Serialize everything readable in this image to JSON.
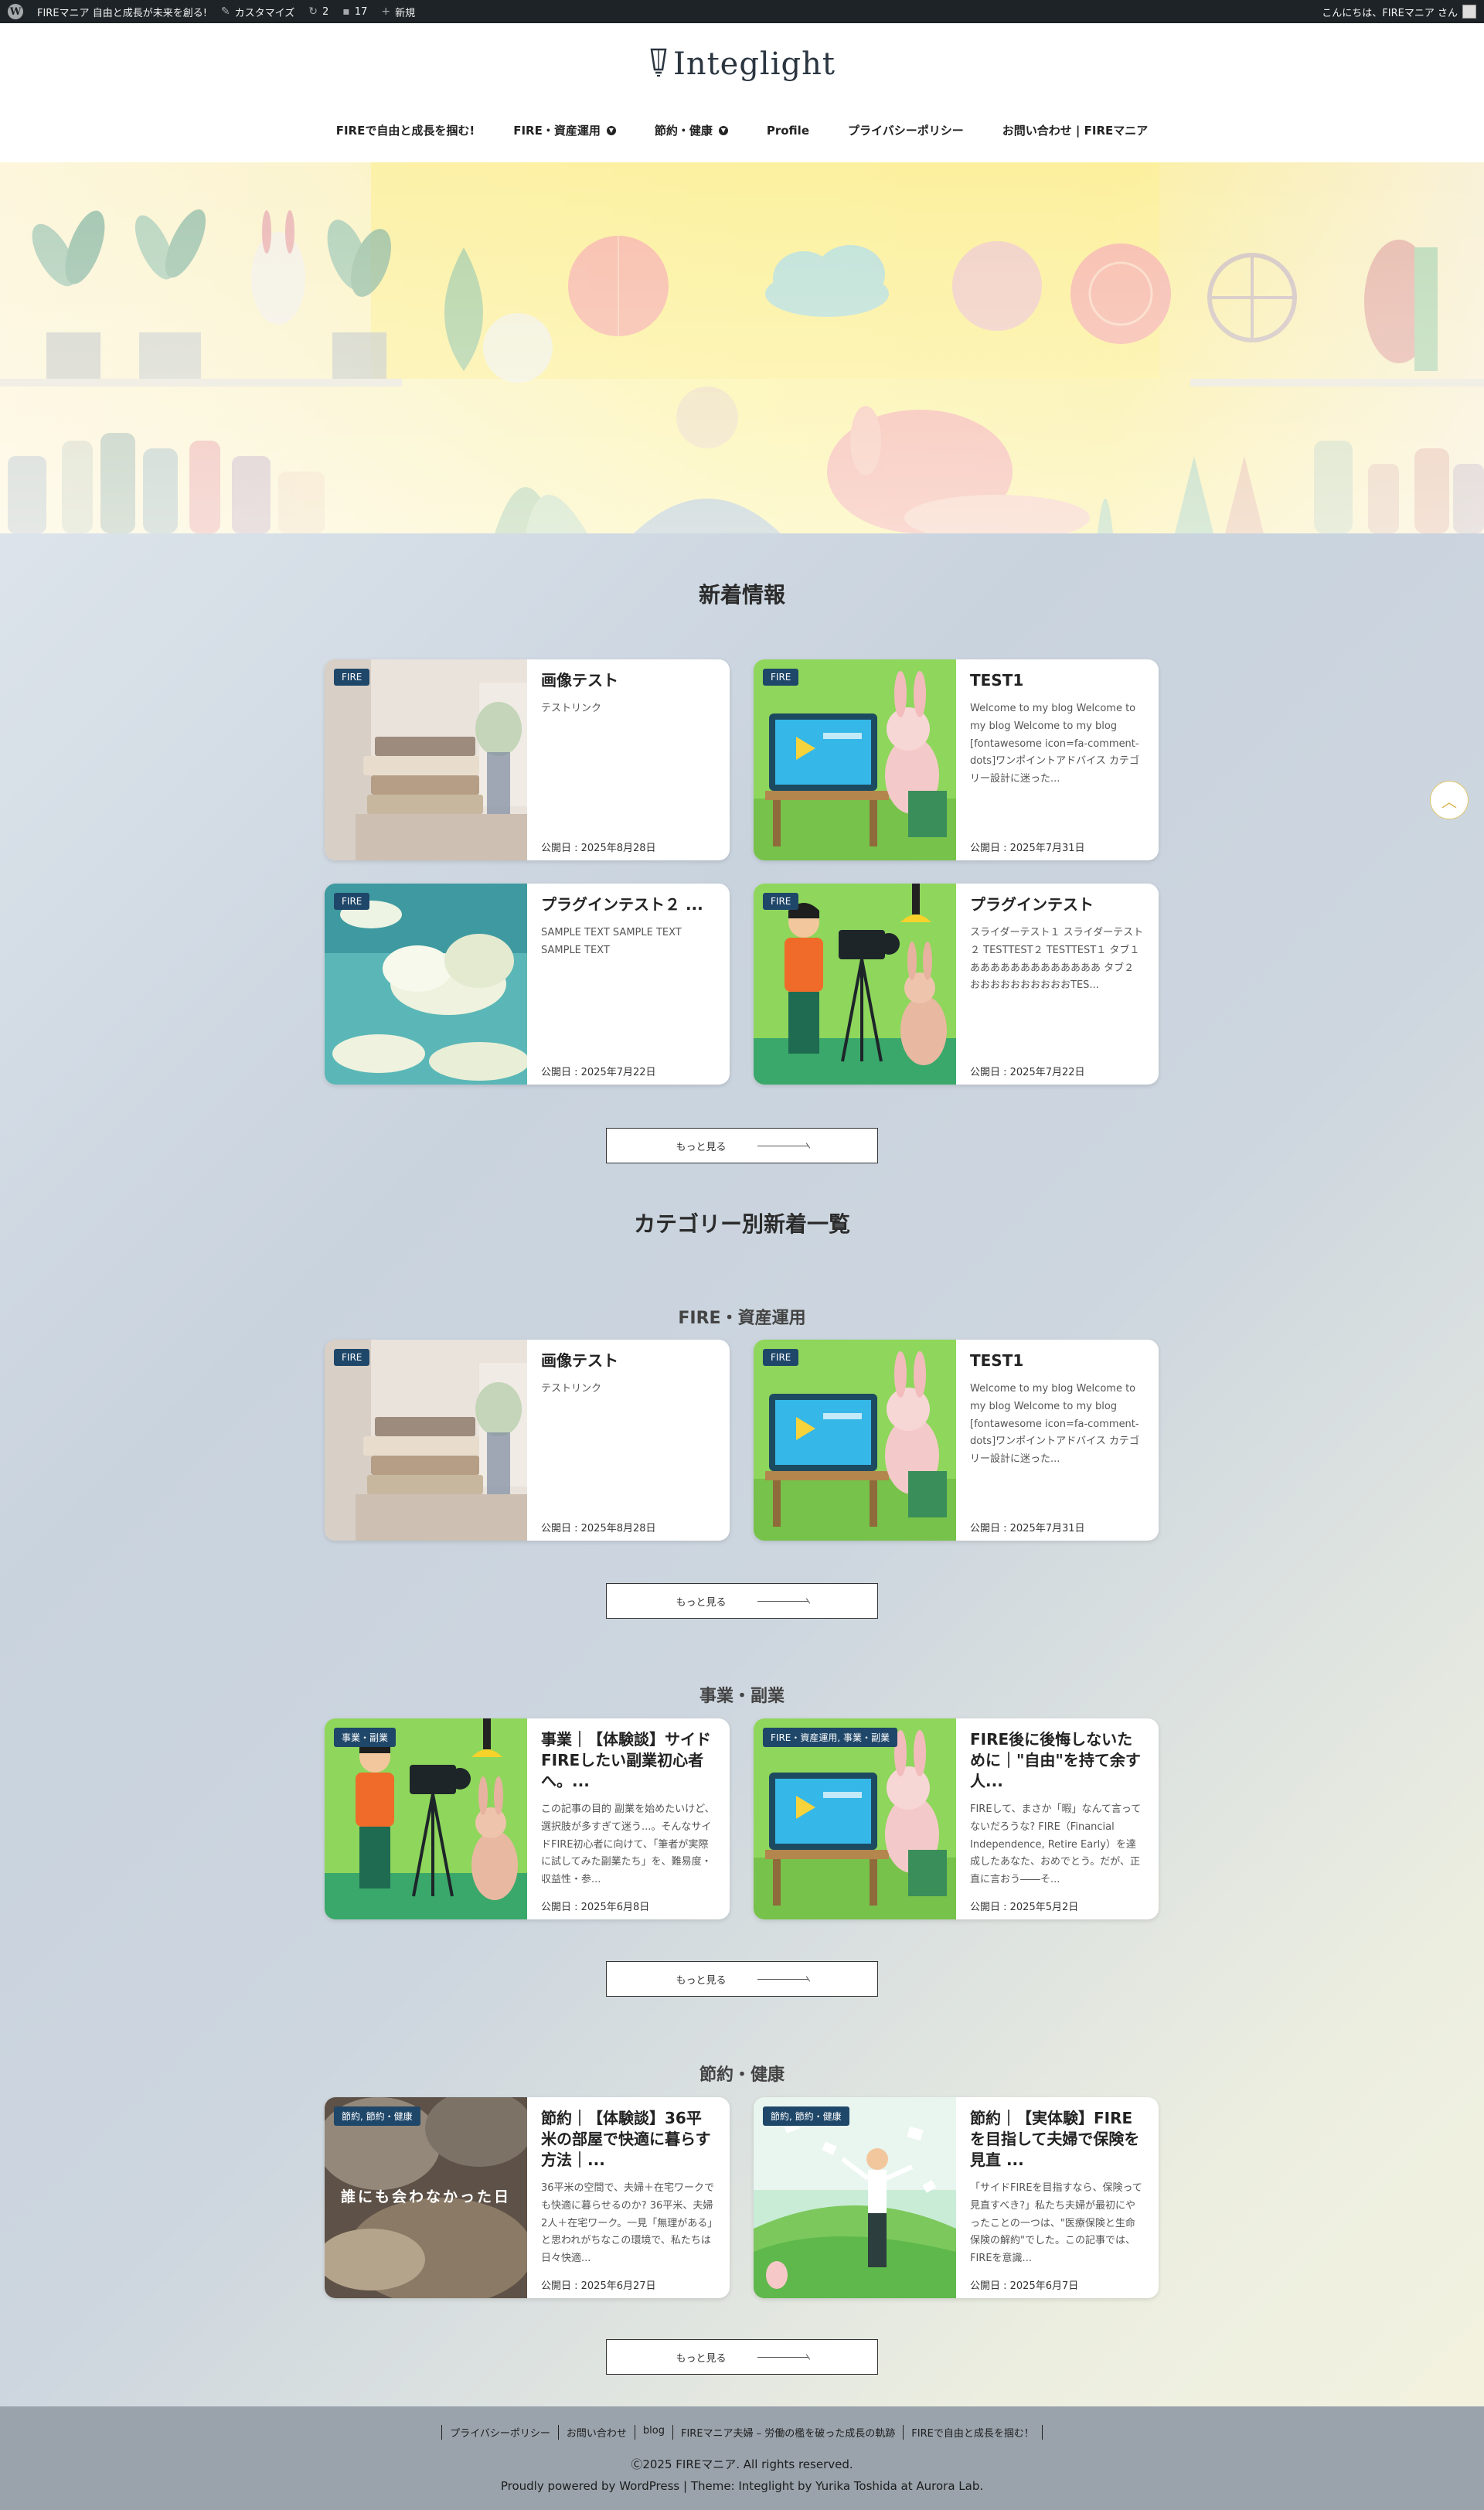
{
  "adminbar": {
    "site_name": "FIREマニア 自由と成長が未来を創る!",
    "customize": "カスタマイズ",
    "updates": "2",
    "comments": "17",
    "new": "新規",
    "greeting": "こんにちは、FIREマニア さん"
  },
  "header": {
    "logo": "Integlight",
    "nav": [
      {
        "label": "FIREで自由と成長を掴む!"
      },
      {
        "label": "FIRE・資産運用"
      },
      {
        "label": "節約・健康"
      },
      {
        "label": "Profile"
      },
      {
        "label": "プライバシーポリシー"
      },
      {
        "label": "お問い合わせ | FIREマニア"
      }
    ]
  },
  "latest": {
    "title": "新着情報",
    "cards": [
      {
        "badge": "FIRE",
        "title": "画像テスト",
        "excerpt": "テストリンク",
        "date": "公開日 : 2025年8月28日",
        "thumb": "books"
      },
      {
        "badge": "FIRE",
        "title": "TEST1",
        "excerpt": "Welcome to my blog Welcome to my blog Welcome to my blog [fontawesome icon=fa-comment-dots]ワンポイントアドバイス カテゴリー設計に迷った...",
        "date": "公開日 : 2025年7月31日",
        "thumb": "rabbit-computer"
      },
      {
        "badge": "FIRE",
        "title": "プラグインテスト２ ...",
        "excerpt": "SAMPLE TEXT SAMPLE TEXT SAMPLE TEXT",
        "date": "公開日 : 2025年7月22日",
        "thumb": "clouds"
      },
      {
        "badge": "FIRE",
        "title": "プラグインテスト",
        "excerpt": "スライダーテスト１ スライダーテスト２ TESTTEST２ TESTTEST１ タブ１ あああああああああああああ タブ２ おおおおおおおおおおTES...",
        "date": "公開日 : 2025年7月22日",
        "thumb": "camera"
      }
    ],
    "more": "もっと見る"
  },
  "category_section": {
    "title": "カテゴリー別新着一覧",
    "groups": [
      {
        "title": "FIRE・資産運用",
        "cards": [
          {
            "badge": "FIRE",
            "title": "画像テスト",
            "excerpt": "テストリンク",
            "date": "公開日 : 2025年8月28日",
            "thumb": "books"
          },
          {
            "badge": "FIRE",
            "title": "TEST1",
            "excerpt": "Welcome to my blog Welcome to my blog Welcome to my blog [fontawesome icon=fa-comment-dots]ワンポイントアドバイス カテゴリー設計に迷った...",
            "date": "公開日 : 2025年7月31日",
            "thumb": "rabbit-computer"
          }
        ],
        "more": "もっと見る"
      },
      {
        "title": "事業・副業",
        "cards": [
          {
            "badge": "事業・副業",
            "title": "事業｜【体験談】サイドFIREしたい副業初心者へ。...",
            "excerpt": "この記事の目的 副業を始めたいけど、選択肢が多すぎて迷う...。そんなサイドFIRE初心者に向けて、「筆者が実際に試してみた副業たち」を、難易度・収益性・参...",
            "date": "公開日 : 2025年6月8日",
            "thumb": "camera"
          },
          {
            "badge": "FIRE・資産運用, 事業・副業",
            "title": "FIRE後に後悔しないために｜\"自由\"を持て余す人...",
            "excerpt": "FIREして、まさか「暇」なんて言ってないだろうな? FIRE（Financial Independence, Retire Early）を達成したあなた、おめでとう。だが、正直に言おう――そ...",
            "date": "公開日 : 2025年5月2日",
            "thumb": "rabbit-computer"
          }
        ],
        "more": "もっと見る"
      },
      {
        "title": "節約・健康",
        "cards": [
          {
            "badge": "節約, 節約・健康",
            "title": "節約｜【体験談】36平米の部屋で快適に暮らす方法｜...",
            "excerpt": "36平米の空間で、夫婦＋在宅ワークでも快適に暮らせるのか? 36平米、夫婦2人＋在宅ワーク。一見「無理がある」と思われがちなこの環境で、私たちは日々快適...",
            "date": "公開日 : 2025年6月27日",
            "thumb": "photo",
            "thumb_text": "誰にも会わなかった日"
          },
          {
            "badge": "節約, 節約・健康",
            "title": "節約｜【実体験】FIREを目指して夫婦で保険を見直 ...",
            "excerpt": "「サイドFIREを目指すなら、保険って見直すべき?」私たち夫婦が最初にやったことの一つは、\"医療保険と生命保険の解約\"でした。この記事では、FIREを意識...",
            "date": "公開日 : 2025年6月7日",
            "thumb": "man-papers"
          }
        ],
        "more": "もっと見る"
      }
    ]
  },
  "footer": {
    "links": [
      "プライバシーポリシー",
      "お問い合わせ",
      "blog",
      "FIREマニア夫婦 – 労働の檻を破った成長の軌跡",
      "FIREで自由と成長を掴む！"
    ],
    "copyright": "Ⓒ2025 FIREマニア. All rights reserved.",
    "powered": "Proudly powered by WordPress | Theme: Integlight by Yurika Toshida at Aurora Lab."
  },
  "colors": {
    "badge": "#1f4769",
    "footer": "#9aa3ac",
    "adminbar": "#1d2327"
  },
  "icons": [
    "wordpress-icon",
    "brush-icon",
    "refresh-icon",
    "comment-icon",
    "plus-icon",
    "chevron-down-icon",
    "arrow-up-icon"
  ]
}
